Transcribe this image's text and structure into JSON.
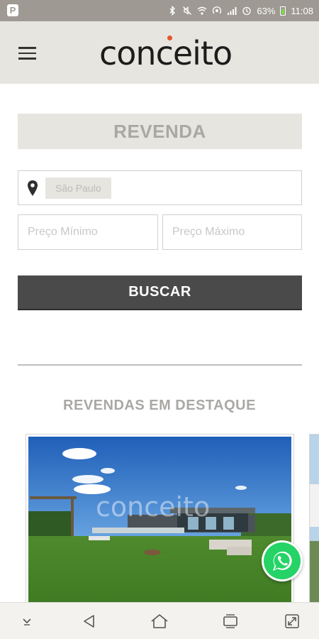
{
  "status_bar": {
    "app_badge": "P",
    "battery_percent": "63%",
    "time": "11:08",
    "icons": [
      "bluetooth-icon",
      "mute-icon",
      "wifi-icon",
      "hotspot-icon",
      "signal-icon",
      "alarm-icon",
      "battery-icon"
    ]
  },
  "header": {
    "logo_text": "conceito",
    "menu_icon": "hamburger-menu-icon",
    "colors": {
      "header_bg": "#e7e5df",
      "logo_dot": "#e5552a"
    }
  },
  "search": {
    "title": "REVENDA",
    "location_chip": "São Paulo",
    "price_min_placeholder": "Preço Mínimo",
    "price_max_placeholder": "Preço Máximo",
    "button_label": "BUSCAR",
    "colors": {
      "button_bg": "#4a4a4a"
    }
  },
  "featured": {
    "section_title": "REVENDAS EM DESTAQUE",
    "image_watermark": "conceito"
  },
  "fab": {
    "icon": "whatsapp-icon",
    "color": "#25d366"
  },
  "nav_bar": {
    "icons": [
      "keyboard-hide-icon",
      "back-icon",
      "home-icon",
      "recents-icon",
      "screen-rotate-icon"
    ]
  }
}
